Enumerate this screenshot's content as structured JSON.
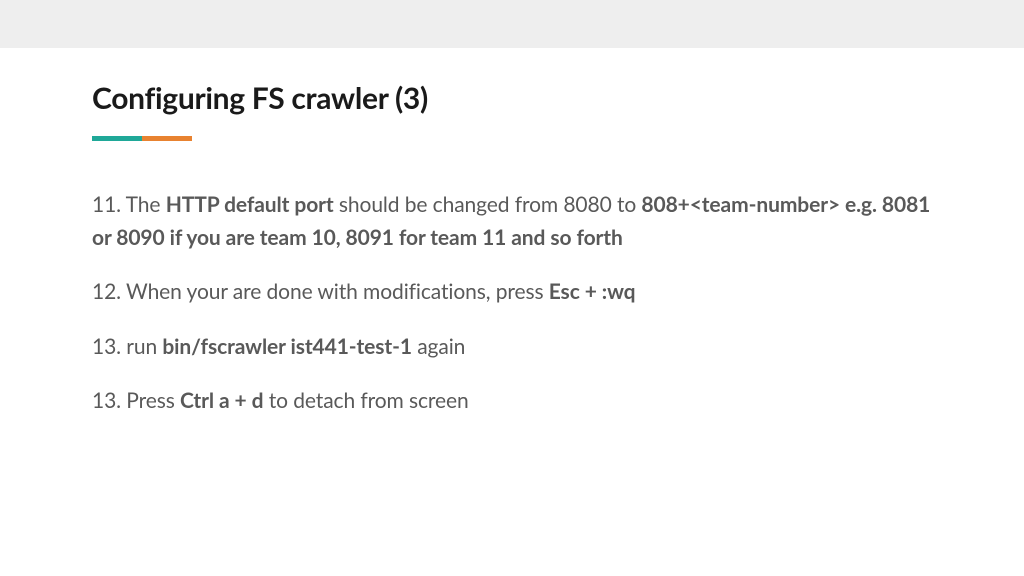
{
  "title": "Configuring FS crawler (3)",
  "items": {
    "step11": {
      "num": "11.",
      "text1": " The ",
      "bold1": "HTTP default port",
      "text2": " should be changed from 8080 to ",
      "bold2": "808+<team-number>   e.g. 8081 or 8090 if you are team 10, 8091 for team 11 and so forth"
    },
    "step12": {
      "num": "12.",
      "text1": " When your are done with modifications, press ",
      "bold1": "Esc + :wq"
    },
    "step13a": {
      "num": "13.",
      "text1": " run ",
      "bold1": "bin/fscrawler ist441-test-1",
      "text2": " again"
    },
    "step13b": {
      "num": "13.",
      "text1": " Press  ",
      "bold1": "Ctrl a + d",
      "text2": "  to detach from screen"
    }
  }
}
